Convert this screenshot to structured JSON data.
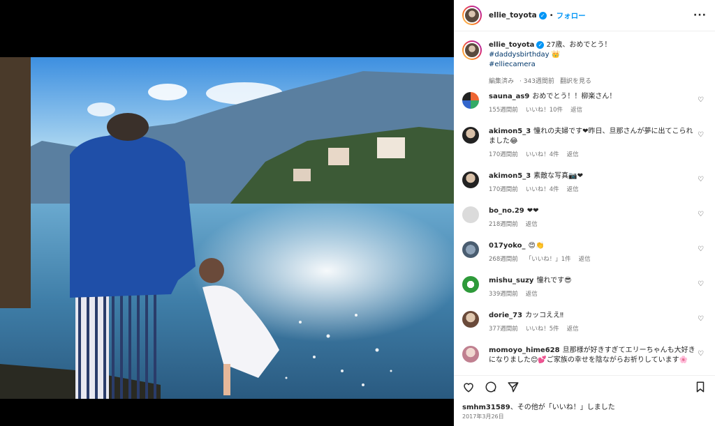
{
  "post": {
    "username": "ellie_toyota",
    "follow_label": "フォロー",
    "caption_text": "27歳、おめでとう！",
    "caption_tags": [
      "#daddysbirthday 👑",
      "#elliecamera"
    ],
    "edited_label": "編集済み",
    "caption_age": "343週間前",
    "translate_label": "翻訳を見る"
  },
  "comments": [
    {
      "user": "sauna_as9",
      "text": "おめでとう！！柳楽さん！",
      "age": "155週間前",
      "likes": "いいね！10件",
      "reply": "返信"
    },
    {
      "user": "akimon5_3",
      "text": "憧れの夫婦です❤昨日、旦那さんが夢に出てこられました😂",
      "age": "170週間前",
      "likes": "いいね！4件",
      "reply": "返信"
    },
    {
      "user": "akimon5_3",
      "text": "素敵な写真📷❤",
      "age": "170週間前",
      "likes": "いいね！4件",
      "reply": "返信"
    },
    {
      "user": "bo_no.29",
      "text": "❤❤",
      "age": "218週間前",
      "likes": "",
      "reply": "返信"
    },
    {
      "user": "017yoko_",
      "text": "😍👏",
      "age": "268週間前",
      "likes": "「いいね！」1件",
      "reply": "返信"
    },
    {
      "user": "mishu_suzy",
      "text": "憧れです😎",
      "age": "339週間前",
      "likes": "",
      "reply": "返信"
    },
    {
      "user": "dorie_73",
      "text": "カッコええ‼",
      "age": "377週間前",
      "likes": "いいね！5件",
      "reply": "返信"
    },
    {
      "user": "momoyo_hime628",
      "text": "旦那様が好きすぎてエリーちゃんも大好きになりました😊💕ご家族の幸せを陰ながらお祈りしています🌸",
      "age": "",
      "likes": "",
      "reply": ""
    }
  ],
  "likes_text": {
    "user": "smhm31589",
    "rest": "、その他が「いいね！」しました"
  },
  "post_date": "2017年3月26日",
  "icons": [
    "heart-icon",
    "comment-icon",
    "share-icon",
    "bookmark-icon",
    "more-icon",
    "verified-badge-icon"
  ],
  "colors": {
    "link": "#0095f6",
    "hashtag": "#00376b",
    "muted": "#737373"
  }
}
